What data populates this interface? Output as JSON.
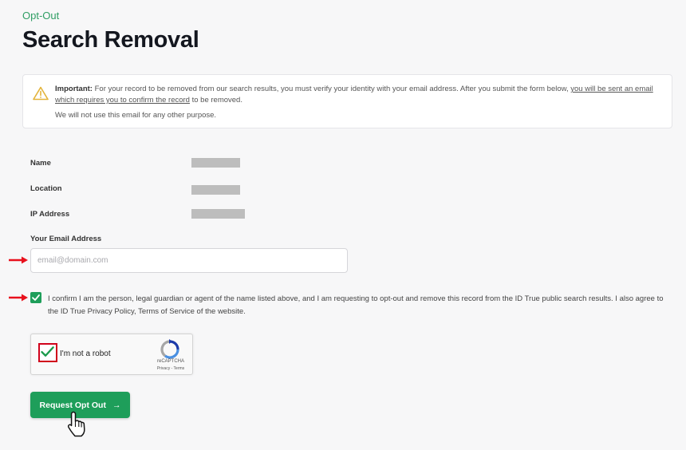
{
  "header": {
    "eyebrow": "Opt-Out",
    "title": "Search Removal"
  },
  "notice": {
    "important_label": "Important:",
    "text_1": " For your record to be removed from our search results, you must verify your identity with your email address. After you submit the form below, ",
    "link_text": "you will be sent an email which requires you to confirm the record",
    "text_2": " to be removed.",
    "secondary": "We will not use this email for any other purpose.",
    "icon": "warning-icon"
  },
  "fields": [
    {
      "label": "Name",
      "value": ""
    },
    {
      "label": "Location",
      "value": ""
    },
    {
      "label": "IP Address",
      "value": ""
    }
  ],
  "email": {
    "label": "Your Email Address",
    "placeholder": "email@domain.com",
    "value": ""
  },
  "confirm": {
    "checked": true,
    "text": "I confirm I am the person, legal guardian or agent of the name listed above, and I am requesting to opt-out and remove this record from the ID True public search results. I also agree to the ID True Privacy Policy, Terms of Service of the website."
  },
  "recaptcha": {
    "label": "I'm not a robot",
    "brand": "reCAPTCHA",
    "terms": "Privacy - Terms",
    "checked": true
  },
  "submit": {
    "label": "Request Opt Out",
    "arrow": "→"
  },
  "colors": {
    "accent": "#1e9e5a",
    "eyebrow": "#2f9e64",
    "annotation_red": "#e8101c"
  }
}
